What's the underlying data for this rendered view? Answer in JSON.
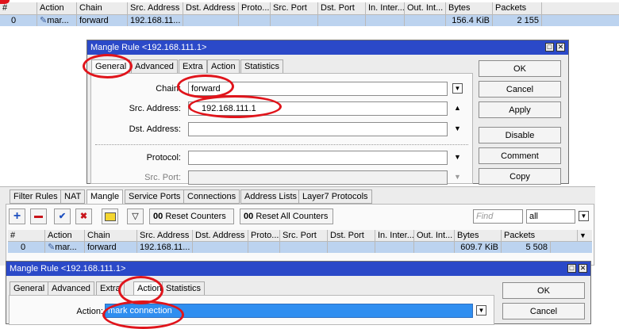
{
  "top_table": {
    "headers": [
      "#",
      "Action",
      "Chain",
      "Src. Address",
      "Dst. Address",
      "Proto...",
      "Src. Port",
      "Dst. Port",
      "In. Inter...",
      "Out. Int...",
      "Bytes",
      "Packets"
    ],
    "row": {
      "num": "0",
      "action": "mar...",
      "chain": "forward",
      "src": "192.168.11...",
      "bytes": "156.4 KiB",
      "packets": "2 155"
    }
  },
  "rule_window_1": {
    "title": "Mangle Rule <192.168.111.1>",
    "tabs": [
      "General",
      "Advanced",
      "Extra",
      "Action",
      "Statistics"
    ],
    "fields": {
      "chain_label": "Chain:",
      "chain_value": "forward",
      "src_label": "Src. Address:",
      "src_value": "192.168.111.1",
      "dst_label": "Dst. Address:",
      "protocol_label": "Protocol:",
      "srcport_label": "Src. Port:"
    },
    "buttons": [
      "OK",
      "Cancel",
      "Apply",
      "Disable",
      "Comment",
      "Copy"
    ]
  },
  "main_tabs": [
    "Filter Rules",
    "NAT",
    "Mangle",
    "Service Ports",
    "Connections",
    "Address Lists",
    "Layer7 Protocols"
  ],
  "toolbar": {
    "reset_counters": "Reset Counters",
    "reset_all_counters": "Reset All Counters",
    "oo": "00",
    "find_placeholder": "Find",
    "filter_value": "all"
  },
  "main_table": {
    "headers": [
      "#",
      "Action",
      "Chain",
      "Src. Address",
      "Dst. Address",
      "Proto...",
      "Src. Port",
      "Dst. Port",
      "In. Inter...",
      "Out. Int...",
      "Bytes",
      "Packets"
    ],
    "row": {
      "num": "0",
      "action": "mar...",
      "chain": "forward",
      "src": "192.168.11...",
      "bytes": "609.7 KiB",
      "packets": "5 508"
    }
  },
  "rule_window_2": {
    "title": "Mangle Rule <192.168.111.1>",
    "tabs": [
      "General",
      "Advanced",
      "Extra",
      "Action",
      "Statistics"
    ],
    "action_label": "Action:",
    "action_value": "mark connection",
    "buttons": [
      "OK",
      "Cancel"
    ]
  },
  "colors": {
    "titlebar": "#2b49c8",
    "selection": "#bcd3ef",
    "annotation": "#e0141b"
  }
}
